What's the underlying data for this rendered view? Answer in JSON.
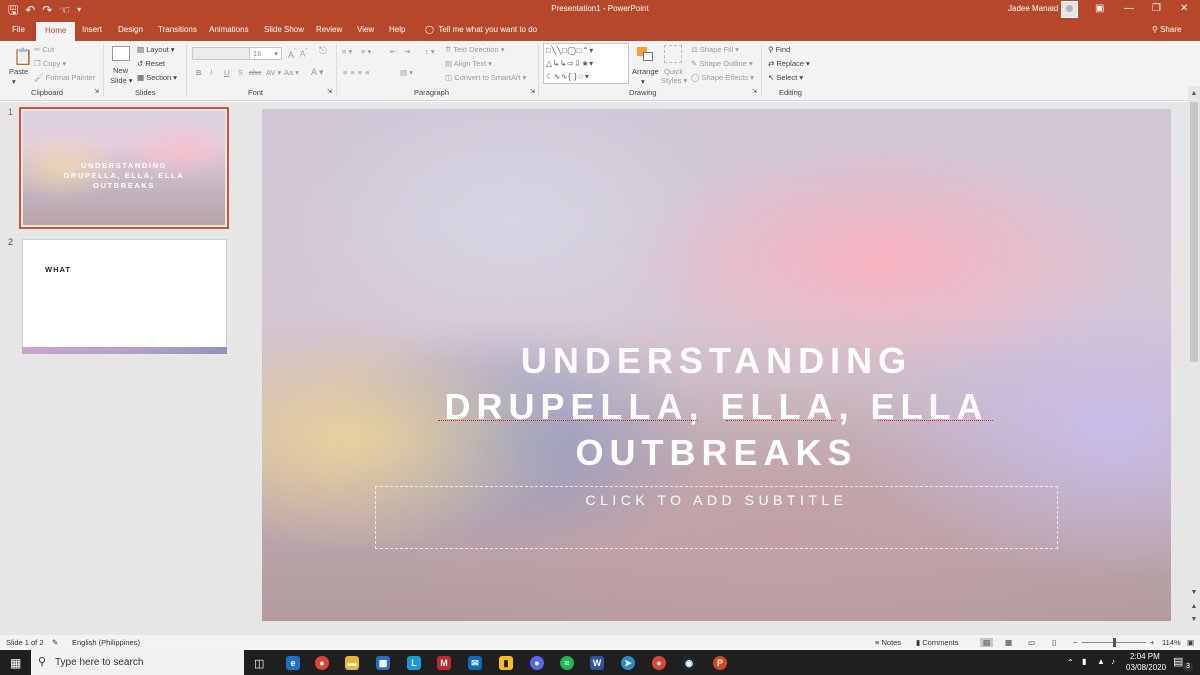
{
  "window": {
    "title": "Presentation1  -  PowerPoint",
    "user": "Jadee Manaid",
    "share": "Share"
  },
  "quick_access": [
    "save-icon",
    "undo-icon",
    "redo-icon",
    "touch-mode-icon",
    "customize-icon"
  ],
  "tabs": [
    "File",
    "Home",
    "Insert",
    "Design",
    "Transitions",
    "Animations",
    "Slide Show",
    "Review",
    "View",
    "Help"
  ],
  "active_tab": "Home",
  "tell_me": "Tell me what you want to do",
  "ribbon": {
    "clipboard": {
      "paste": "Paste",
      "cut": "Cut",
      "copy": "Copy",
      "format_painter": "Format Painter",
      "label": "Clipboard"
    },
    "slides": {
      "new_slide_1": "New",
      "new_slide_2": "Slide",
      "layout": "Layout",
      "reset": "Reset",
      "section": "Section",
      "label": "Slides"
    },
    "font": {
      "size": "16",
      "label": "Font",
      "bold": "B",
      "italic": "I",
      "underline": "U",
      "strike": "S",
      "grow": "A",
      "shrink": "A",
      "case": "Aa",
      "color": "A"
    },
    "paragraph": {
      "text_direction": "Text Direction",
      "align_text": "Align Text",
      "smartart": "Convert to SmartArt",
      "label": "Paragraph"
    },
    "drawing": {
      "arrange": "Arrange",
      "quick_styles_1": "Quick",
      "quick_styles_2": "Styles",
      "shape_fill": "Shape Fill",
      "shape_outline": "Shape Outline",
      "shape_effects": "Shape Effects",
      "label": "Drawing"
    },
    "editing": {
      "find": "Find",
      "replace": "Replace",
      "select": "Select",
      "label": "Editing"
    }
  },
  "thumbnails": [
    {
      "num": "1",
      "title_lines": [
        "UNDERSTANDING",
        "DRUPELLA, ELLA, ELLA",
        "OUTBREAKS"
      ]
    },
    {
      "num": "2",
      "title": "WHAT"
    }
  ],
  "slide": {
    "title_lines": [
      "UNDERSTANDING",
      "DRUPELLA, ELLA, ELLA",
      "OUTBREAKS"
    ],
    "subtitle_placeholder": "CLICK TO ADD SUBTITLE"
  },
  "status": {
    "slide_of": "Slide 1 of 2",
    "language": "English (Philippines)",
    "notes": "Notes",
    "comments": "Comments",
    "zoom": "114%"
  },
  "taskbar": {
    "search_placeholder": "Type here to search",
    "time": "2:04 PM",
    "date": "03/08/2020",
    "notification_badge": "3"
  },
  "colors": {
    "accent": "#b7472a",
    "taskbar": "#1f1f1f"
  }
}
